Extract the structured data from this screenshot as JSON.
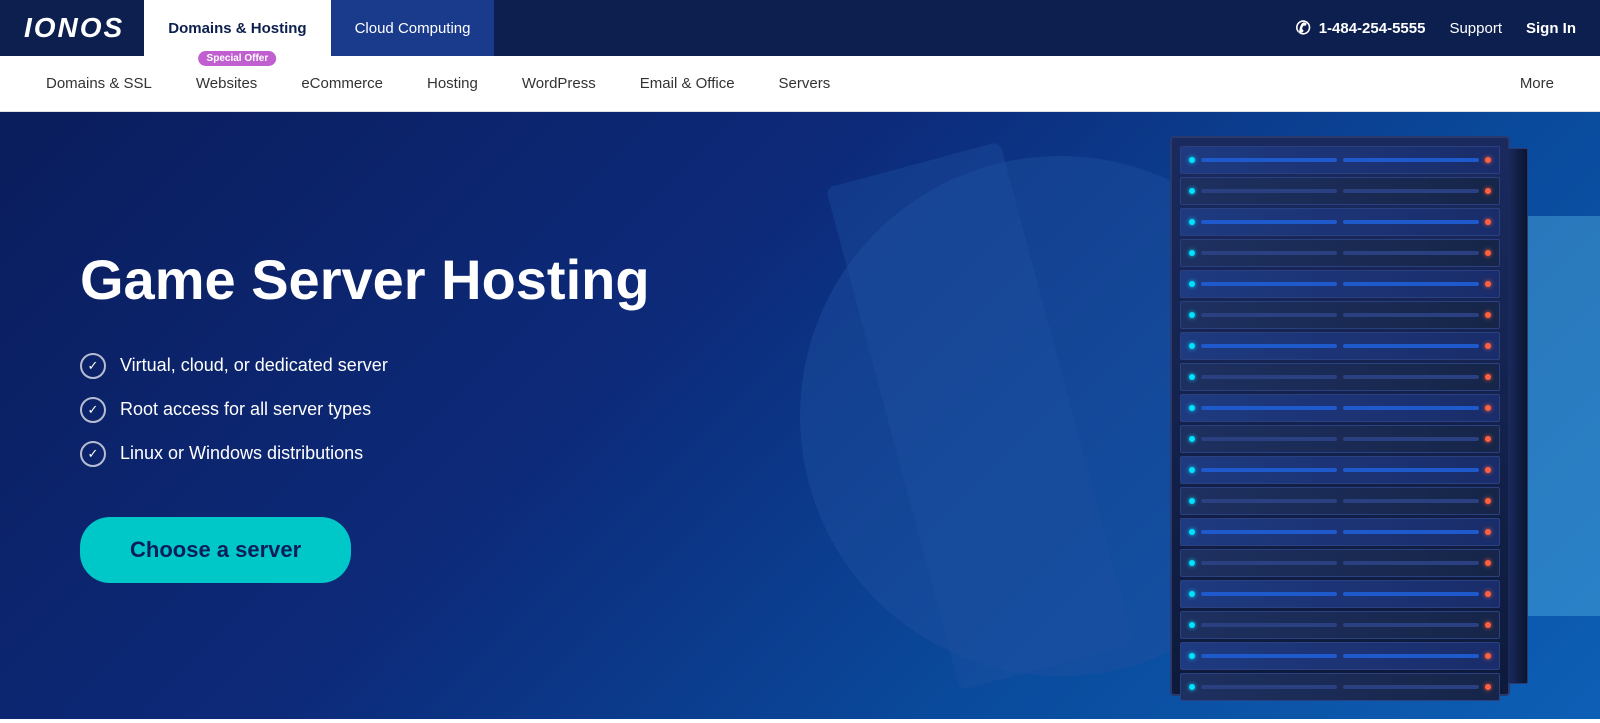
{
  "brand": {
    "logo": "IONOS"
  },
  "topBar": {
    "tabs": [
      {
        "id": "domains-hosting",
        "label": "Domains & Hosting",
        "active": true,
        "cloud": false
      },
      {
        "id": "cloud-computing",
        "label": "Cloud Computing",
        "active": false,
        "cloud": true
      }
    ],
    "specialOffer": "Special Offer",
    "phone": "1-484-254-5555",
    "support": "Support",
    "signIn": "Sign In"
  },
  "secondaryNav": {
    "items": [
      {
        "id": "domains-ssl",
        "label": "Domains & SSL"
      },
      {
        "id": "websites",
        "label": "Websites"
      },
      {
        "id": "ecommerce",
        "label": "eCommerce"
      },
      {
        "id": "hosting",
        "label": "Hosting"
      },
      {
        "id": "wordpress",
        "label": "WordPress"
      },
      {
        "id": "email-office",
        "label": "Email & Office"
      },
      {
        "id": "servers",
        "label": "Servers"
      }
    ],
    "more": "More"
  },
  "hero": {
    "title": "Game Server Hosting",
    "features": [
      "Virtual, cloud, or dedicated server",
      "Root access for all server types",
      "Linux or Windows distributions"
    ],
    "ctaButton": "Choose a server"
  }
}
